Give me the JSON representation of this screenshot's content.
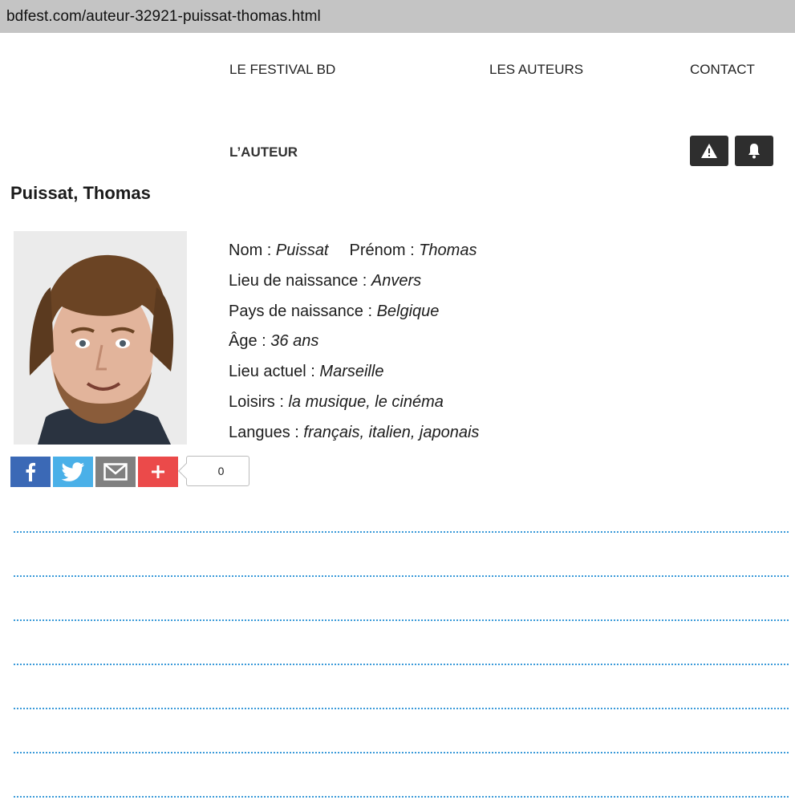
{
  "browser": {
    "url": "bdfest.com/auteur-32921-puissat-thomas.html"
  },
  "nav": {
    "festival": "LE FESTIVAL BD",
    "auteurs": "LES AUTEURS",
    "contact": "CONTACT"
  },
  "section": {
    "label": "L’AUTEUR"
  },
  "author": {
    "title": "Puissat, Thomas",
    "nom_label": "Nom : ",
    "nom": "Puissat",
    "prenom_label": "Prénom : ",
    "prenom": "Thomas",
    "lieu_naissance_label": "Lieu de naissance : ",
    "lieu_naissance": "Anvers",
    "pays_label": "Pays de naissance : ",
    "pays": "Belgique",
    "age_label": "Âge : ",
    "age": "36 ans",
    "lieu_actuel_label": "Lieu actuel : ",
    "lieu_actuel": "Marseille",
    "loisirs_label": "Loisirs : ",
    "loisirs": "la musique, le cinéma",
    "langues_label": "Langues : ",
    "langues": "français, italien, japonais"
  },
  "share": {
    "count": "0",
    "icons": [
      "facebook-icon",
      "twitter-icon",
      "mail-icon",
      "plus-icon"
    ],
    "colors": {
      "facebook": "#3b69b6",
      "twitter": "#4ab0e8",
      "mail": "#808080",
      "plus": "#eb4a4a"
    }
  },
  "actions": {
    "icons": [
      "warning-icon",
      "bell-icon"
    ]
  },
  "accent": {
    "dotted_line": "#3a9ad9"
  }
}
